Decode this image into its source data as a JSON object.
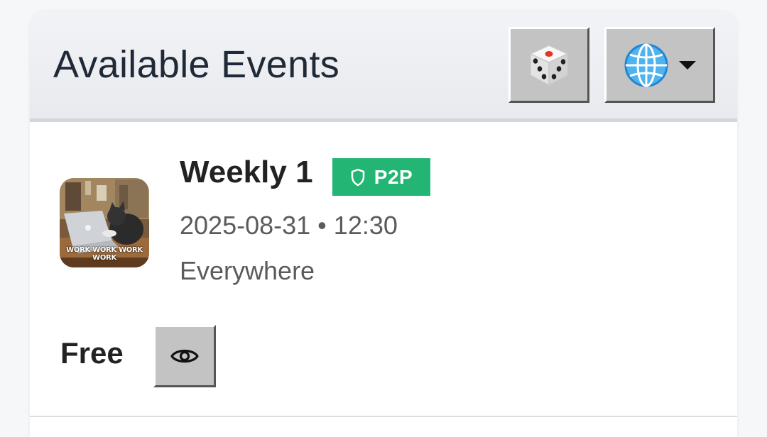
{
  "header": {
    "title": "Available Events",
    "dice_icon": "dice-icon",
    "language_icon": "globe-icon"
  },
  "event": {
    "title": "Weekly 1",
    "badge": "P2P",
    "badge_icon": "shield-icon",
    "badge_color": "#22b573",
    "date": "2025-08-31",
    "separator": "•",
    "time": "12:30",
    "location": "Everywhere",
    "thumbnail_caption": "WORK WORK WORK WORK",
    "price": "Free",
    "view_icon": "eye-icon"
  }
}
